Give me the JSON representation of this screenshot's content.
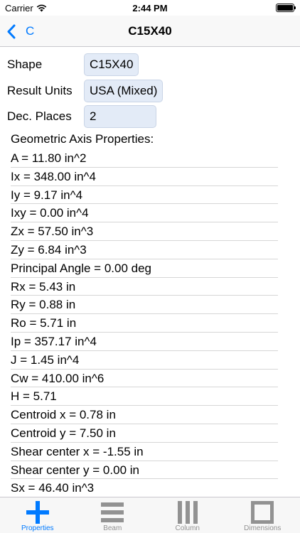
{
  "status": {
    "carrier": "Carrier",
    "time": "2:44 PM"
  },
  "nav": {
    "back_label": "C",
    "title": "C15X40"
  },
  "form": {
    "shape": {
      "label": "Shape",
      "value": "C15X40"
    },
    "units": {
      "label": "Result Units",
      "value": "USA (Mixed)"
    },
    "decimals": {
      "label": "Dec. Places",
      "value": "2"
    }
  },
  "properties": {
    "heading": "Geometric Axis Properties:",
    "items": [
      "A = 11.80 in^2",
      "Ix = 348.00 in^4",
      "Iy = 9.17 in^4",
      "Ixy = 0.00 in^4",
      "Zx = 57.50 in^3",
      "Zy = 6.84 in^3",
      "Principal Angle = 0.00 deg",
      "Rx = 5.43 in",
      "Ry = 0.88 in",
      "Ro = 5.71 in",
      "Ip = 357.17 in^4",
      "J = 1.45 in^4",
      "Cw = 410.00 in^6",
      "H = 5.71",
      "Centroid x = 0.78 in",
      "Centroid y = 7.50 in",
      "Shear center x = -1.55 in",
      "Shear center y = 0.00 in",
      "Sx = 46.40 in^3"
    ]
  },
  "tabs": [
    {
      "label": "Properties",
      "icon": "plus-icon",
      "active": true
    },
    {
      "label": "Beam",
      "icon": "beam-icon",
      "active": false
    },
    {
      "label": "Column",
      "icon": "column-icon",
      "active": false
    },
    {
      "label": "Dimensions",
      "icon": "dimensions-icon",
      "active": false
    }
  ],
  "colors": {
    "accent": "#007aff",
    "field_bg": "#e3ebf7",
    "inactive": "#929292"
  }
}
